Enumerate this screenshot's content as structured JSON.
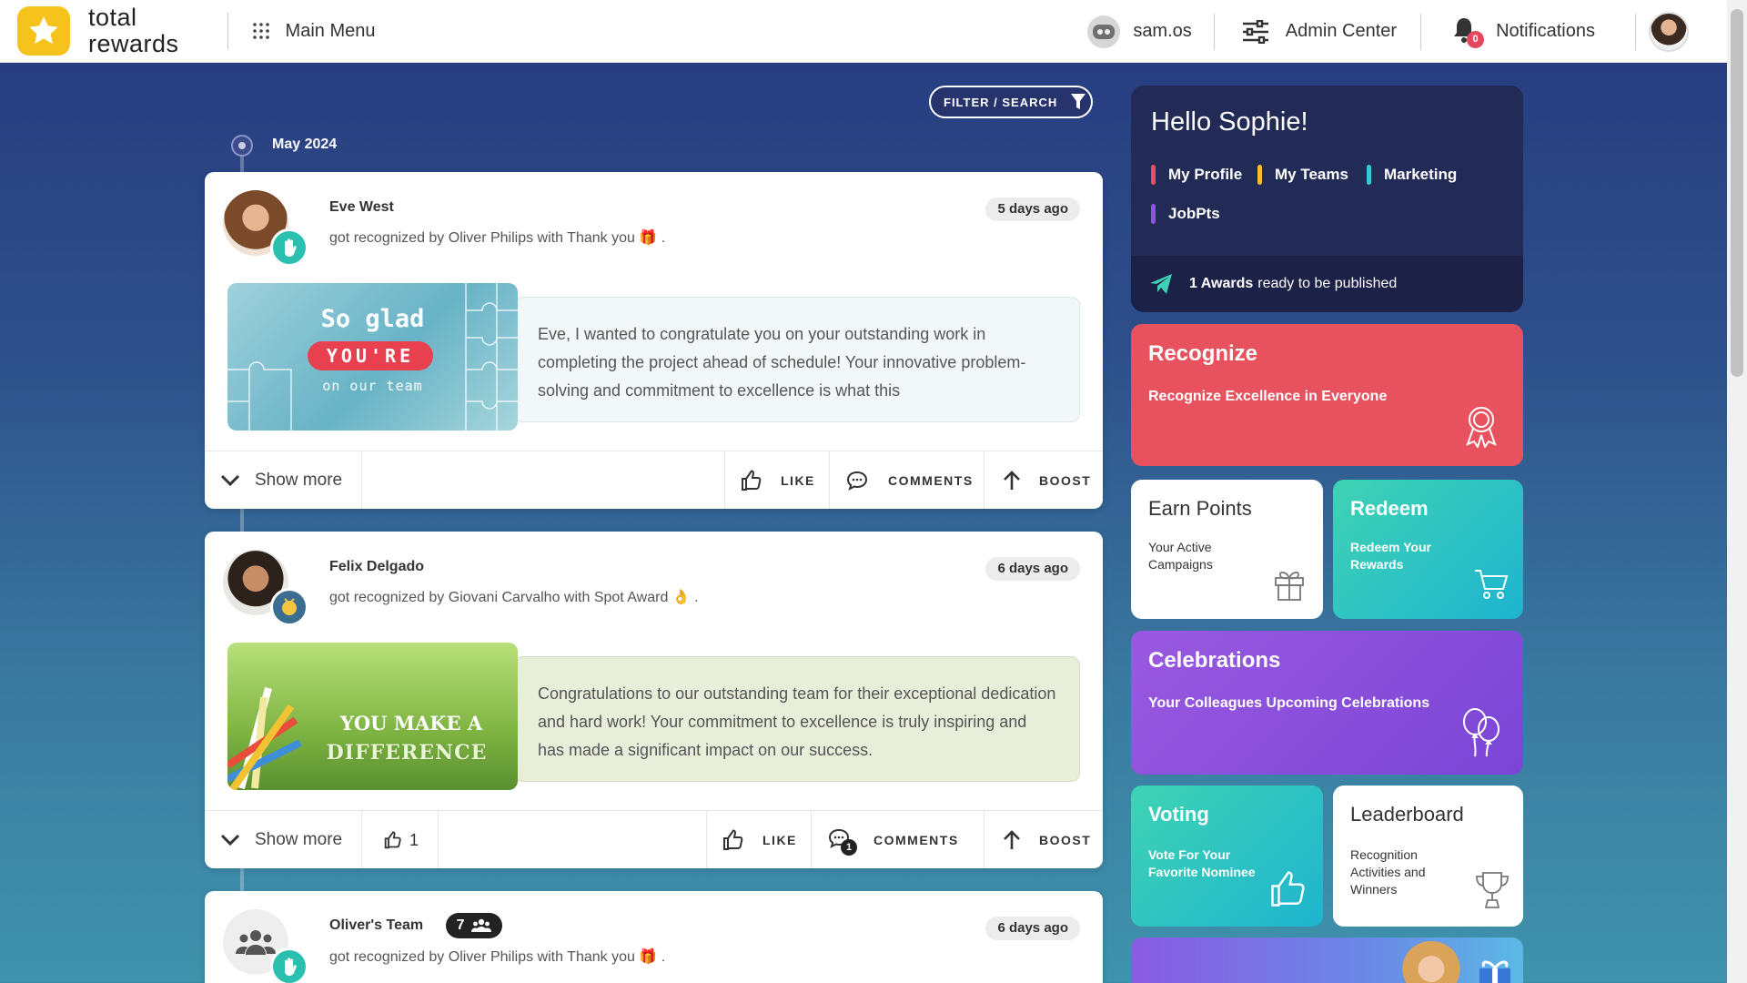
{
  "app": {
    "brand_line1": "total",
    "brand_line2": "rewards"
  },
  "header": {
    "main_menu": "Main Menu",
    "user": "sam.os",
    "admin_center": "Admin Center",
    "notifications": "Notifications",
    "notification_count": "0"
  },
  "feed": {
    "filter_label": "FILTER / SEARCH",
    "month": "May 2024",
    "footer": {
      "show_more": "Show more",
      "like": "LIKE",
      "comments": "COMMENTS",
      "boost": "BOOST"
    },
    "posts": [
      {
        "name": "Eve West",
        "desc": "got recognized by Oliver Philips with Thank you 🎁 .",
        "time": "5 days ago",
        "ecard_line1": "So glad",
        "ecard_line2": "YOU'RE",
        "ecard_line3": "on our team",
        "message": "Eve, I wanted to congratulate you on your outstanding work in completing the project ahead of schedule! Your innovative problem-solving and commitment to excellence is what this"
      },
      {
        "name": "Felix Delgado",
        "desc": "got recognized by Giovani Carvalho with Spot Award 👌 .",
        "time": "6 days ago",
        "ecard_line1": "YOU MAKE A",
        "ecard_line2": "DIFFERENCE",
        "message": "Congratulations to our outstanding team for their exceptional dedication and hard work! Your commitment to excellence is truly inspiring and has made a significant impact on our success.",
        "like_count": "1",
        "comment_count": "1"
      },
      {
        "name": "Oliver's Team",
        "team_count": "7",
        "desc": "got recognized by Oliver Philips with Thank you 🎁 .",
        "time": "6 days ago"
      }
    ]
  },
  "side": {
    "greeting": "Hello Sophie!",
    "links": [
      {
        "label": "My Profile",
        "color": "#e8505f"
      },
      {
        "label": "My Teams",
        "color": "#f3c02a"
      },
      {
        "label": "Marketing",
        "color": "#3dc6d8"
      },
      {
        "label": "JobPts",
        "color": "#8a55e0"
      }
    ],
    "awards_count": "1 Awards",
    "awards_text": "ready to be published",
    "tiles": {
      "recognize": {
        "title": "Recognize",
        "sub": "Recognize Excellence in Everyone"
      },
      "earn": {
        "title": "Earn Points",
        "sub1": "Your Active",
        "sub2": "Campaigns"
      },
      "redeem": {
        "title": "Redeem",
        "sub1": "Redeem Your",
        "sub2": "Rewards"
      },
      "celebrations": {
        "title": "Celebrations",
        "sub": "Your Colleagues Upcoming Celebrations"
      },
      "voting": {
        "title": "Voting",
        "sub1": "Vote For Your",
        "sub2": "Favorite Nominee"
      },
      "leaderboard": {
        "title": "Leaderboard",
        "sub1": "Recognition",
        "sub2": "Activities and",
        "sub3": "Winners"
      }
    }
  }
}
